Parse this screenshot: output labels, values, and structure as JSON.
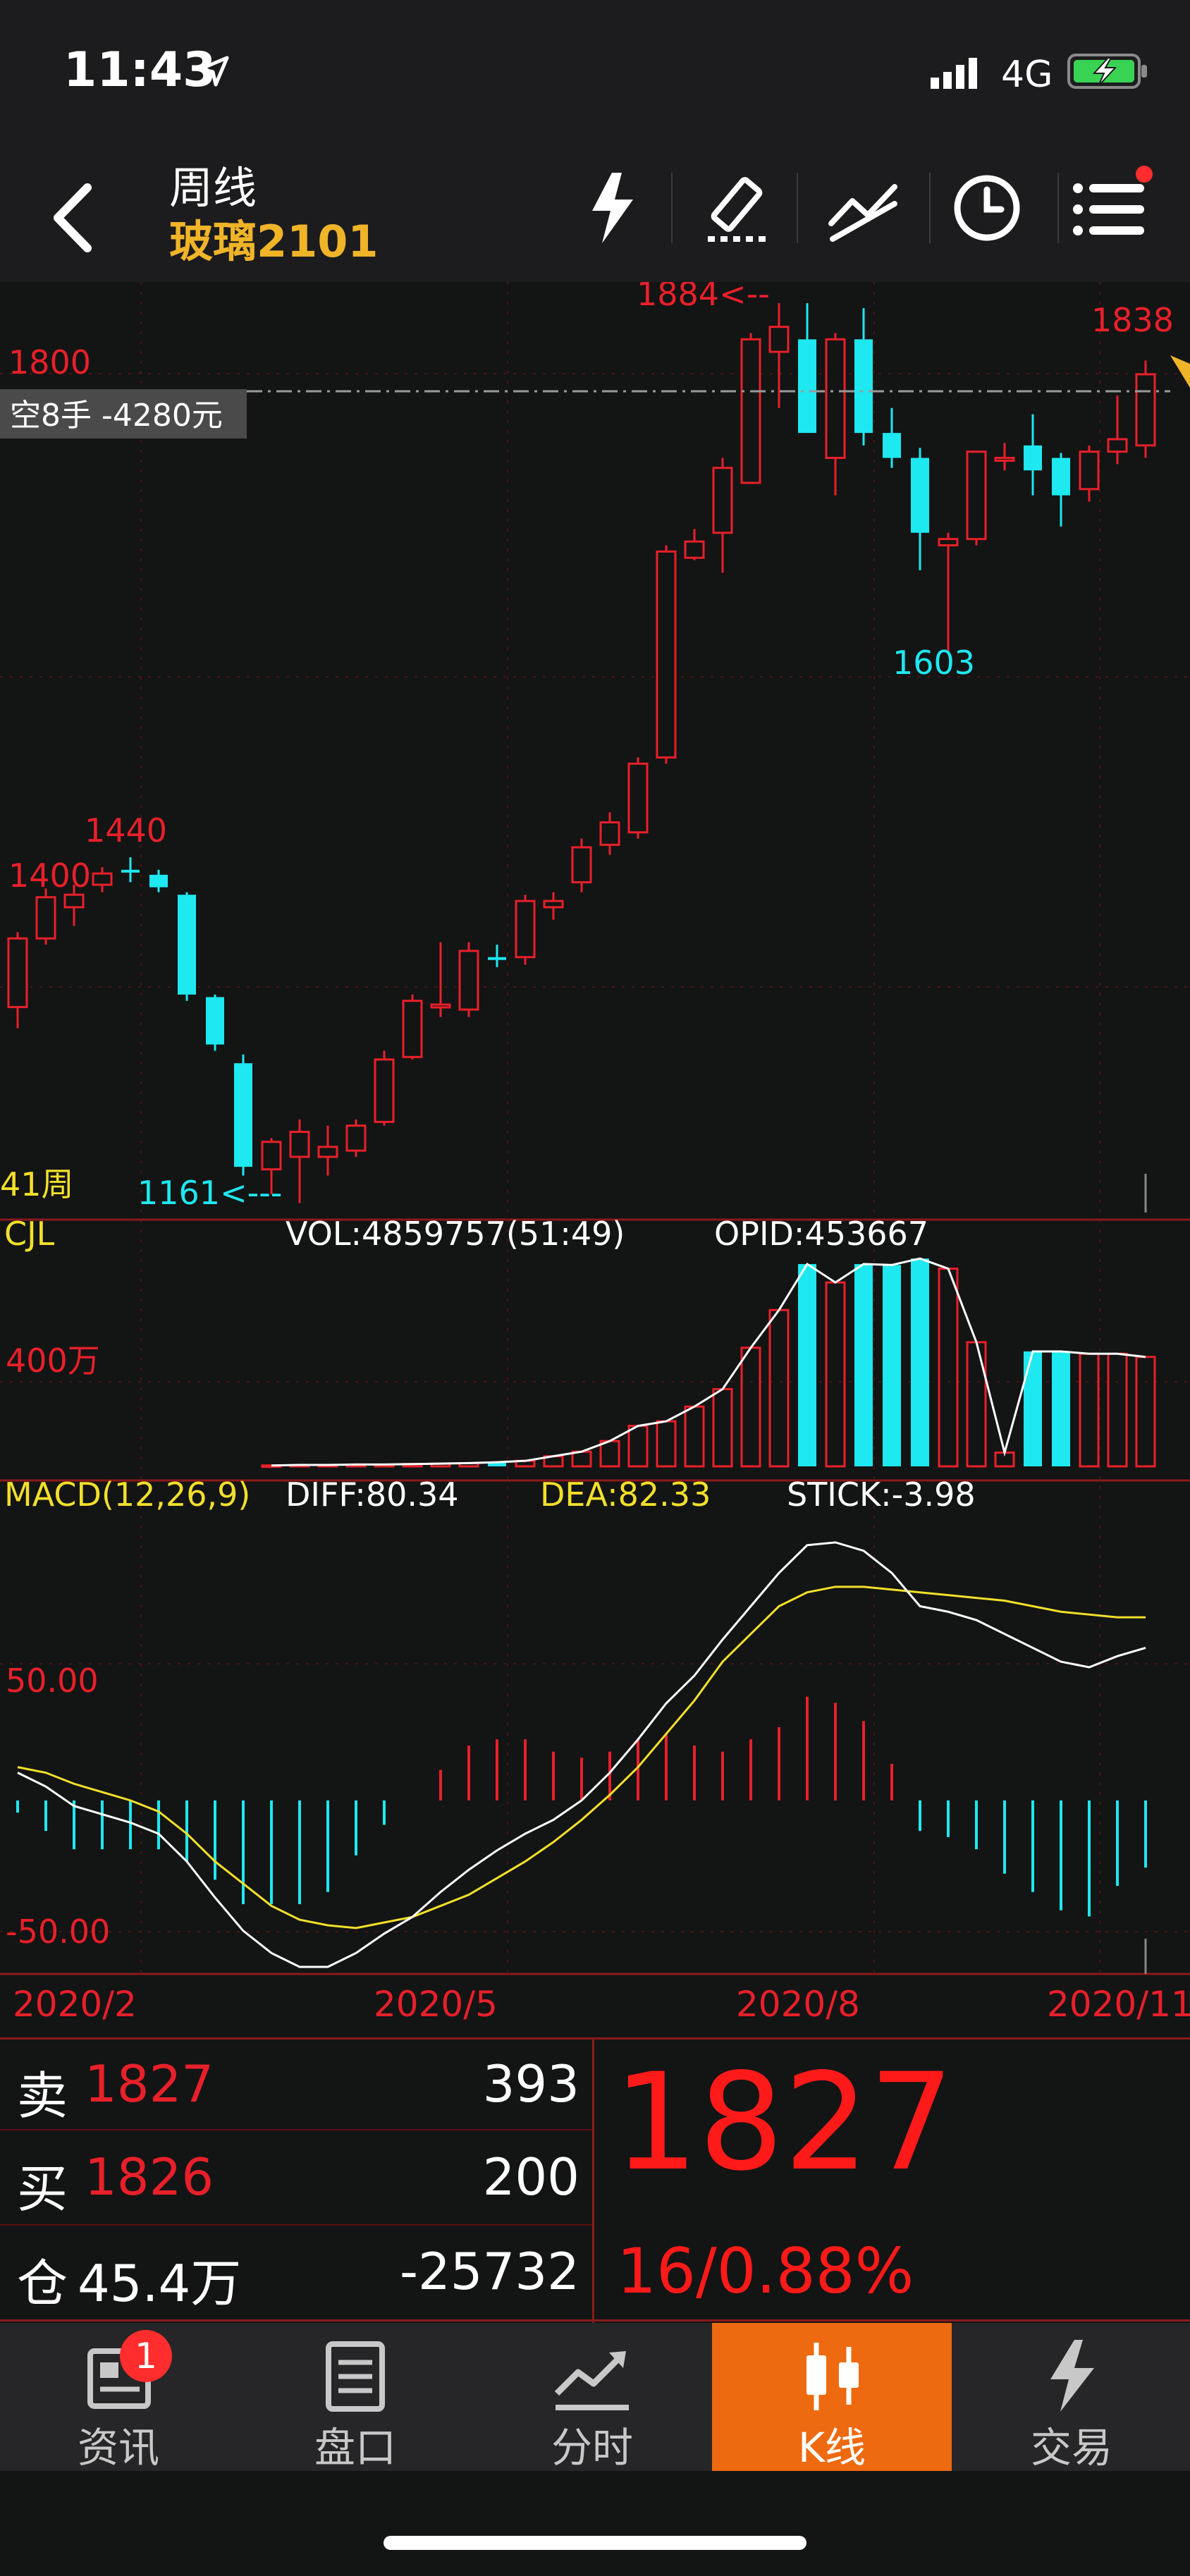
{
  "status_bar": {
    "time": "11:43",
    "network": "4G",
    "icons": [
      "location-arrow-icon",
      "signal-icon",
      "battery-charging-icon"
    ]
  },
  "header": {
    "title": "周线",
    "subtitle": "玻璃2101",
    "icons": [
      "back-icon",
      "flash-icon",
      "draw-pen-icon",
      "line-tool-icon",
      "clock-icon",
      "menu-icon"
    ]
  },
  "chart": {
    "price_labels": {
      "high_arrow": "1884<--",
      "last_high": "1838",
      "level_1800": "1800",
      "level_1400": "1400",
      "left_peak": "1440",
      "low_arrow": "1161<---",
      "mid_low": "1603"
    },
    "position_tag": "空8手 -4280元",
    "period_count": "41周",
    "volume": {
      "name": "CJL",
      "vol": "VOL:4859757(51:49)",
      "opid": "OPID:453667",
      "axis_label": "400万"
    },
    "macd": {
      "name": "MACD(12,26,9)",
      "diff": "DIFF:80.34",
      "dea": "DEA:82.33",
      "stick": "STICK:-3.98",
      "axis_top": "50.00",
      "axis_bottom": "-50.00"
    },
    "x_labels": [
      "2020/2",
      "2020/5",
      "2020/8",
      "2020/11"
    ],
    "colors": {
      "up": "#e8202a",
      "down": "#1ee8f0",
      "diff": "#ffffff",
      "dea": "#f2e02a"
    }
  },
  "chart_data": {
    "type": "candlestick",
    "period": "weekly",
    "symbol": "玻璃2101",
    "ohlc": [
      [
        1320,
        1380,
        1303,
        1375
      ],
      [
        1375,
        1415,
        1370,
        1408
      ],
      [
        1400,
        1418,
        1385,
        1410
      ],
      [
        1418,
        1432,
        1412,
        1427
      ],
      [
        1430,
        1440,
        1420,
        1428
      ],
      [
        1426,
        1430,
        1412,
        1416
      ],
      [
        1410,
        1412,
        1325,
        1330
      ],
      [
        1328,
        1330,
        1285,
        1290
      ],
      [
        1275,
        1282,
        1185,
        1192
      ],
      [
        1190,
        1215,
        1170,
        1212
      ],
      [
        1200,
        1230,
        1163,
        1220
      ],
      [
        1200,
        1225,
        1185,
        1208
      ],
      [
        1205,
        1230,
        1200,
        1225
      ],
      [
        1228,
        1285,
        1225,
        1278
      ],
      [
        1280,
        1330,
        1278,
        1325
      ],
      [
        1320,
        1372,
        1312,
        1322
      ],
      [
        1318,
        1372,
        1312,
        1365
      ],
      [
        1360,
        1370,
        1352,
        1358
      ],
      [
        1360,
        1410,
        1354,
        1405
      ],
      [
        1400,
        1412,
        1390,
        1405
      ],
      [
        1420,
        1455,
        1412,
        1448
      ],
      [
        1450,
        1476,
        1442,
        1468
      ],
      [
        1460,
        1520,
        1455,
        1515
      ],
      [
        1520,
        1690,
        1515,
        1685
      ],
      [
        1680,
        1703,
        1678,
        1693
      ],
      [
        1700,
        1760,
        1668,
        1752
      ],
      [
        1740,
        1860,
        1740,
        1855
      ],
      [
        1845,
        1884,
        1800,
        1865
      ],
      [
        1855,
        1884,
        1790,
        1780
      ],
      [
        1760,
        1860,
        1730,
        1855
      ],
      [
        1855,
        1880,
        1770,
        1780
      ],
      [
        1780,
        1800,
        1752,
        1760
      ],
      [
        1760,
        1768,
        1670,
        1700
      ],
      [
        1690,
        1700,
        1603,
        1695
      ],
      [
        1695,
        1765,
        1690,
        1765
      ],
      [
        1760,
        1772,
        1750,
        1760
      ],
      [
        1770,
        1795,
        1730,
        1750
      ],
      [
        1760,
        1764,
        1705,
        1730
      ],
      [
        1735,
        1770,
        1725,
        1765
      ],
      [
        1765,
        1810,
        1755,
        1775
      ],
      [
        1770,
        1838,
        1760,
        1827
      ]
    ],
    "volume_top_values": [
      2,
      3,
      3,
      4,
      4,
      5,
      6,
      7,
      9,
      12,
      22,
      32,
      55,
      88,
      98,
      130,
      168,
      258,
      340,
      440,
      400,
      440,
      438,
      452,
      430,
      270,
      30,
      250,
      250,
      245,
      245,
      238
    ],
    "macd_diff": [
      10,
      5,
      -2,
      -5,
      -8,
      -12,
      -22,
      -35,
      -47,
      -55,
      -60,
      -60,
      -55,
      -48,
      -42,
      -33,
      -25,
      -18,
      -12,
      -7,
      0,
      10,
      22,
      35,
      45,
      58,
      70,
      82,
      92,
      93,
      90,
      82,
      70,
      68,
      65,
      60,
      55,
      50,
      48,
      52,
      55
    ],
    "macd_dea": [
      12,
      10,
      6,
      3,
      0,
      -4,
      -12,
      -22,
      -30,
      -38,
      -43,
      -45,
      -46,
      -44,
      -42,
      -38,
      -34,
      -28,
      -22,
      -15,
      -7,
      2,
      12,
      24,
      36,
      50,
      60,
      70,
      75,
      77,
      77,
      76,
      75,
      74,
      73,
      72,
      70,
      68,
      67,
      66,
      66
    ],
    "x_labels": [
      "2020/2",
      "2020/5",
      "2020/8",
      "2020/11"
    ],
    "ylim_price": [
      1161,
      1884
    ],
    "ylim_macd": [
      -60,
      95
    ]
  },
  "trade_panel": {
    "sell_label": "卖",
    "sell_price": "1827",
    "sell_qty": "393",
    "buy_label": "买",
    "buy_price": "1826",
    "buy_qty": "200",
    "oi_label": "仓",
    "oi_value": "45.4万",
    "oi_change": "-25732",
    "last_price": "1827",
    "change": "16/0.88%"
  },
  "tabs": [
    {
      "label": "资讯",
      "badge": "1",
      "icon": "news-icon"
    },
    {
      "label": "盘口",
      "icon": "orderbook-icon"
    },
    {
      "label": "分时",
      "icon": "intraday-icon"
    },
    {
      "label": "K线",
      "icon": "candlestick-icon",
      "active": true
    },
    {
      "label": "交易",
      "icon": "trade-icon"
    }
  ]
}
